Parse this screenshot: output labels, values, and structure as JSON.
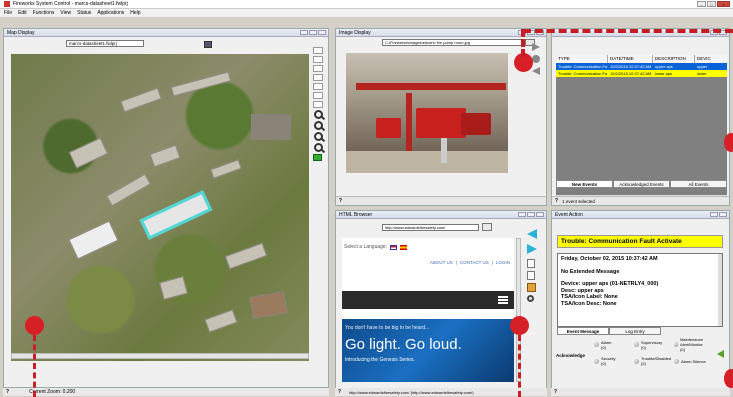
{
  "app": {
    "title": "Fireworks System Control - marcs-datasheet1.fwlprj"
  },
  "menu": [
    "File",
    "Edit",
    "Functions",
    "View",
    "Status",
    "Applications",
    "Help"
  ],
  "map": {
    "title": "Map Display",
    "selected_map": "marcs-datasheet1.fwlprj",
    "status": "Current Zoom: 0.200"
  },
  "image_display": {
    "title": "Image Display",
    "path": "C:\\Firewerks\\Images\\electric fire pump room.jpg"
  },
  "events": {
    "columns": [
      "TYPE",
      "DATE/TIME",
      "DESCRIPTION",
      "DEVIC"
    ],
    "rows": [
      {
        "type": "Trouble: Communication Fa",
        "datetime": "10/2/2015 10:37:42 AM",
        "description": "upper aps",
        "device": "upper"
      },
      {
        "type": "Trouble: Communication Fa",
        "datetime": "10/2/2015 10:37:42 AM",
        "description": "lower aps",
        "device": "lower"
      }
    ],
    "tabs": [
      "New Events",
      "Acknowledged Events",
      "All Events"
    ],
    "status": "1 event selected"
  },
  "browser": {
    "title": "HTML Browser",
    "url": "http://www.edwardsfiresafety.com/",
    "language_label": "Select a Language:",
    "links": [
      "ABOUT US",
      "|",
      "CONTACT US",
      "|",
      "LOGIN"
    ],
    "hero_small": "You don't have to be big to be heard...",
    "hero_big": "Go light. Go loud.",
    "hero_sub": "Introducing the Genesis Series.",
    "status": "http://www.edwardsfiresafety.com/ (http://www.edwardsfiresafety.com/)"
  },
  "event_action": {
    "title": "Event Action",
    "banner": "Trouble: Communication Fault Activate",
    "lines": [
      "Friday, October 02, 2015 10:37:42 AM",
      "",
      "No Extended Message",
      "",
      "Device: upper aps (01-NETRLY4_000)",
      "Desc: upper aps",
      "TSA/Icon Label: None",
      "TSA/Icon Desc: None"
    ],
    "tabs": [
      "Event Message",
      "Log Entry"
    ],
    "acknowledge": "Acknowledge",
    "counters": [
      {
        "label": "Alarm",
        "count": "(0)"
      },
      {
        "label": "Supervisory",
        "count": "(0)"
      },
      {
        "label": "Maintenance Alert/Monitor",
        "count": "(0)"
      },
      {
        "label": "Security",
        "count": "(0)"
      },
      {
        "label": "Trouble/Disabled",
        "count": "(2)"
      },
      {
        "label": "Alarm Silence",
        "count": ""
      }
    ]
  },
  "colors": {
    "highlight_yellow": "#ffff00",
    "selection_blue": "#0a64d8",
    "annotation_red": "#d61f26"
  }
}
